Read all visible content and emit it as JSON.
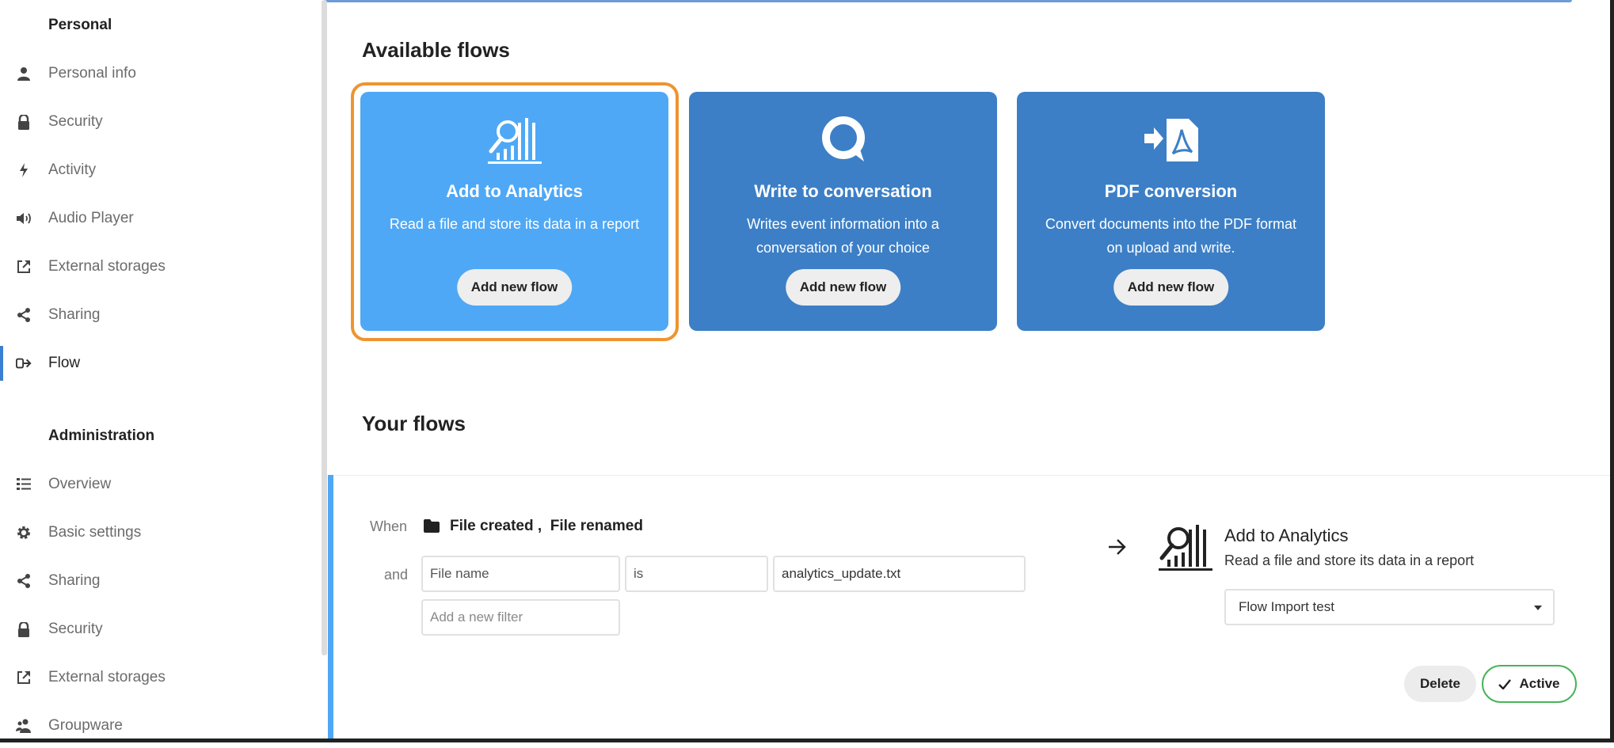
{
  "sidebar": {
    "personal_heading": "Personal",
    "personal_items": [
      {
        "label": "Personal info",
        "icon": "person-icon"
      },
      {
        "label": "Security",
        "icon": "lock-icon"
      },
      {
        "label": "Activity",
        "icon": "lightning-icon"
      },
      {
        "label": "Audio Player",
        "icon": "speaker-icon"
      },
      {
        "label": "External storages",
        "icon": "external-link-icon"
      },
      {
        "label": "Sharing",
        "icon": "share-icon"
      },
      {
        "label": "Flow",
        "icon": "flow-icon",
        "active": true
      }
    ],
    "admin_heading": "Administration",
    "admin_items": [
      {
        "label": "Overview",
        "icon": "list-icon"
      },
      {
        "label": "Basic settings",
        "icon": "gear-icon"
      },
      {
        "label": "Sharing",
        "icon": "share-icon"
      },
      {
        "label": "Security",
        "icon": "lock-icon"
      },
      {
        "label": "External storages",
        "icon": "external-link-icon"
      },
      {
        "label": "Groupware",
        "icon": "group-icon"
      }
    ]
  },
  "available": {
    "heading": "Available flows",
    "cards": [
      {
        "title": "Add to Analytics",
        "desc1": "Read a file and store its data in a report",
        "desc2": "",
        "button": "Add new flow",
        "icon": "analytics-icon",
        "selected": true
      },
      {
        "title": "Write to conversation",
        "desc1": "Writes event information into a",
        "desc2": "conversation of your choice",
        "button": "Add new flow",
        "icon": "talk-icon"
      },
      {
        "title": "PDF conversion",
        "desc1": "Convert documents into the PDF format",
        "desc2": "on upload and write.",
        "button": "Add new flow",
        "icon": "pdf-icon"
      }
    ]
  },
  "your_flows": {
    "heading": "Your flows",
    "when_label": "When",
    "events": "File created ,  File renamed",
    "and_label": "and",
    "filter": {
      "field": "File name",
      "operator": "is",
      "value": "analytics_update.txt"
    },
    "add_filter_placeholder": "Add a new filter",
    "action_title": "Add to Analytics",
    "action_desc": "Read a file and store its data in a report",
    "select_value": "Flow Import test",
    "delete_label": "Delete",
    "active_label": "Active"
  },
  "colors": {
    "accent": "#3a80d2",
    "card": "#3c7fc6",
    "card_selected": "#4fa8f5",
    "outline": "#ee9431",
    "active_border": "#49b35a"
  }
}
